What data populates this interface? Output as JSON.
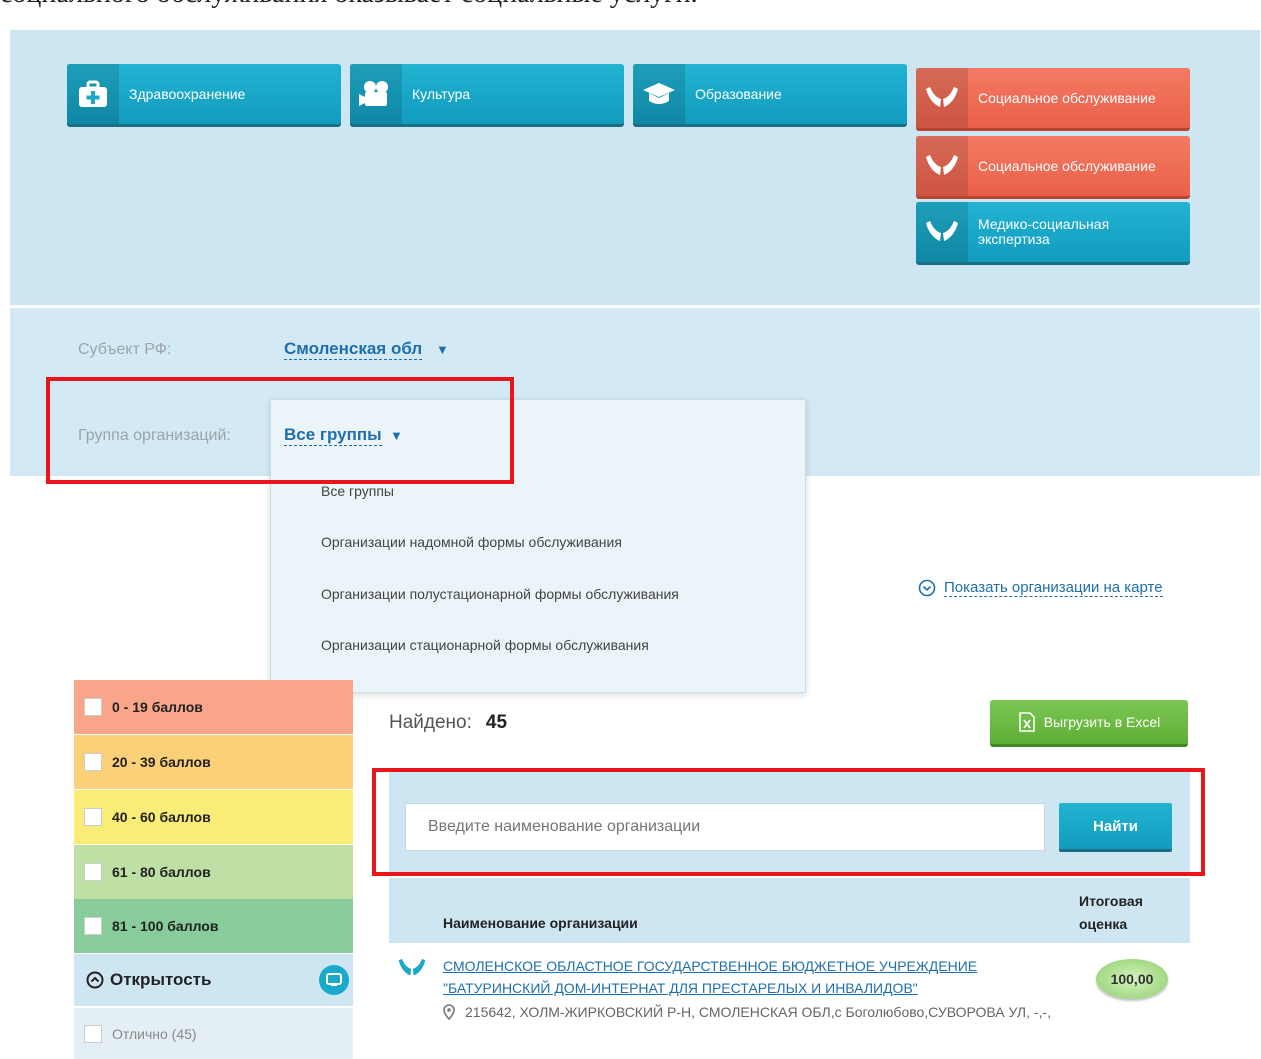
{
  "caption": "социального обслуживания оказывает социальные услуги.",
  "categories": [
    {
      "label": "Здравоохранение",
      "icon": "first-aid-kit-icon"
    },
    {
      "label": "Культура",
      "icon": "film-camera-icon"
    },
    {
      "label": "Образование",
      "icon": "graduation-cap-icon"
    },
    {
      "label": "Социальное обслуживание",
      "icon": "caring-hands-icon"
    },
    {
      "label": "Социальное обслуживание",
      "icon": "caring-hands-icon"
    },
    {
      "label": "Медико-социальная экспертиза",
      "icon": "caring-hands-icon"
    }
  ],
  "filters": {
    "subject_label": "Субъект РФ:",
    "subject_value": "Смоленская обл",
    "group_label": "Группа организаций:",
    "group_value": "Все группы"
  },
  "dropdown_options": [
    "Все группы",
    "Организации надомной формы обслуживания",
    "Организации полустационарной формы обслуживания",
    "Организации стационарной формы обслуживания"
  ],
  "map_link": "Показать организации на карте",
  "score_ranges": [
    {
      "label": "0 - 19 баллов",
      "color": "#f9a58a"
    },
    {
      "label": "20 - 39 баллов",
      "color": "#fccf79"
    },
    {
      "label": "40 - 60 баллов",
      "color": "#f9ec77"
    },
    {
      "label": "61 - 80 баллов",
      "color": "#bfe0a5"
    },
    {
      "label": "81 - 100 баллов",
      "color": "#88cc9c"
    }
  ],
  "openness": {
    "title": "Открытость",
    "item": "Отлично (45)"
  },
  "results": {
    "found_label": "Найдено:",
    "found_count": "45",
    "excel_label": "Выгрузить в Excel"
  },
  "search": {
    "placeholder": "Введите наименование организации",
    "button": "Найти"
  },
  "table": {
    "col_name": "Наименование организации",
    "col_score": "Итоговая оценка",
    "rows": [
      {
        "name": "СМОЛЕНСКОЕ ОБЛАСТНОЕ ГОСУДАРСТВЕННОЕ БЮДЖЕТНОЕ УЧРЕЖДЕНИЕ \"БАТУРИНСКИЙ ДОМ-ИНТЕРНАТ ДЛЯ ПРЕСТАРЕЛЫХ И ИНВАЛИДОВ\"",
        "address": "215642, ХОЛМ-ЖИРКОВСКИЙ Р-Н, СМОЛЕНСКАЯ ОБЛ,с Боголюбово,СУВОРОВА УЛ, -,-,",
        "score": "100,00"
      }
    ]
  },
  "colors": {
    "accent_blue": "#1aa9ca",
    "accent_red": "#ee6b54",
    "highlight": "#e8161b",
    "excel_green": "#6abb43"
  }
}
